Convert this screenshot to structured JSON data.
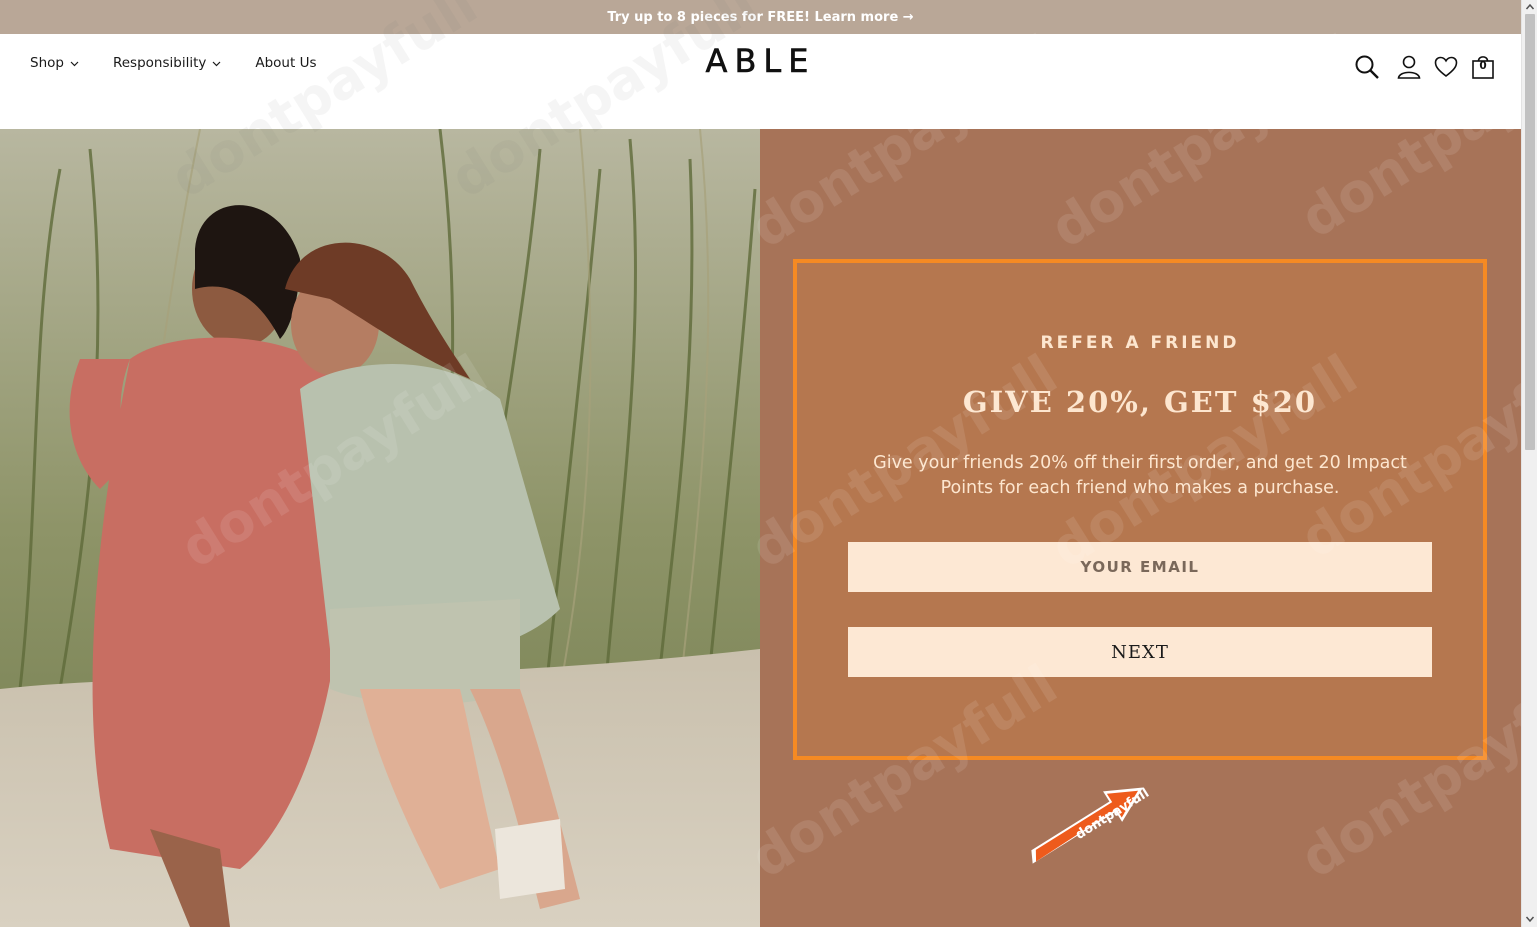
{
  "announcement": {
    "text": "Try up to 8 pieces for FREE! Learn more →"
  },
  "nav": {
    "items": [
      {
        "label": "Shop",
        "has_dropdown": true
      },
      {
        "label": "Responsibility",
        "has_dropdown": true
      },
      {
        "label": "About Us",
        "has_dropdown": false
      }
    ]
  },
  "brand": {
    "logo": "ABLE"
  },
  "header_icons": {
    "search": "search-icon",
    "account": "user-icon",
    "wishlist": "heart-icon",
    "cart": "bag-icon",
    "cart_count": "0"
  },
  "refer": {
    "eyebrow": "REFER A FRIEND",
    "title": "GIVE 20%, GET $20",
    "description": "Give your friends 20% off their first order, and get 20 Impact Points for each friend who makes a purchase.",
    "email_placeholder": "YOUR EMAIL",
    "email_value": "",
    "next_label": "NEXT"
  },
  "overlay": {
    "watermark": "dontpayfull",
    "badge_text": "dontpayfull"
  },
  "colors": {
    "announcement_bg": "#b9a797",
    "panel_bg": "#a77358",
    "box_bg": "#b5774f",
    "box_border": "#f58a23",
    "accent_text": "#fde6cf",
    "input_bg": "#fde8d4"
  }
}
